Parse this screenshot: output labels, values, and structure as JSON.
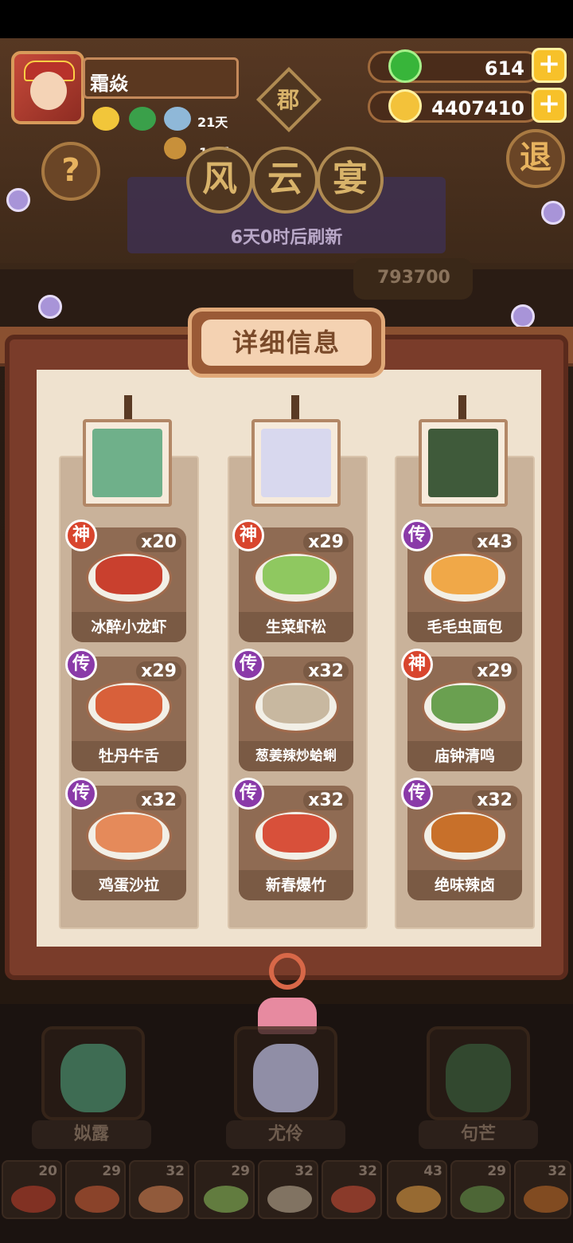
{
  "player": {
    "name": "霜焱",
    "stat1": "21天",
    "stat2": "11天"
  },
  "resources": [
    {
      "name": "jade",
      "value": "614",
      "icon": "jade-coin-icon",
      "color": "#38b53a"
    },
    {
      "name": "gold",
      "value": "4407410",
      "icon": "gold-coin-icon",
      "color": "#f3c23a"
    }
  ],
  "header": {
    "badge": "郡",
    "title_chars": [
      "风",
      "云",
      "宴"
    ],
    "help_label": "?",
    "exit_label": "退",
    "refresh_text": "6天0时后刷新",
    "score": "793700"
  },
  "panel": {
    "title": "详细信息",
    "columns": [
      {
        "dishes": [
          {
            "name": "冰醉小龙虾",
            "count": "x20",
            "rank": "神",
            "color": "#c9402e"
          },
          {
            "name": "牡丹牛舌",
            "count": "x29",
            "rank": "传",
            "color": "#d8603a"
          },
          {
            "name": "鸡蛋沙拉",
            "count": "x32",
            "rank": "传",
            "color": "#e58a5a"
          }
        ]
      },
      {
        "dishes": [
          {
            "name": "生菜虾松",
            "count": "x29",
            "rank": "神",
            "color": "#8fc860"
          },
          {
            "name": "葱姜辣炒蛤蜊",
            "count": "x32",
            "rank": "传",
            "color": "#c8b8a0"
          },
          {
            "name": "新春爆竹",
            "count": "x32",
            "rank": "传",
            "color": "#d8503a"
          }
        ]
      },
      {
        "dishes": [
          {
            "name": "毛毛虫面包",
            "count": "x43",
            "rank": "传",
            "color": "#f0a848"
          },
          {
            "name": "庙钟清鸣",
            "count": "x29",
            "rank": "神",
            "color": "#6aa050"
          },
          {
            "name": "绝味辣卤",
            "count": "x32",
            "rank": "传",
            "color": "#c8702a"
          }
        ]
      }
    ]
  },
  "heroes": [
    {
      "name": "姒露",
      "color": "#4a8a6a"
    },
    {
      "name": "尤伶",
      "color": "#b8b8d8"
    },
    {
      "name": "句芒",
      "color": "#3a5a3a"
    }
  ],
  "slots": [
    {
      "count": "20",
      "color": "#c9402e"
    },
    {
      "count": "29",
      "color": "#8fc860"
    },
    {
      "count": "32",
      "color": "#e58a5a"
    },
    {
      "count": "29",
      "color": "#8fc860"
    },
    {
      "count": "32",
      "color": "#c8b8a0"
    },
    {
      "count": "32",
      "color": "#d8503a"
    },
    {
      "count": "43",
      "color": "#f0a848"
    },
    {
      "count": "29",
      "color": "#6aa050"
    },
    {
      "count": "32",
      "color": "#c8702a"
    }
  ]
}
